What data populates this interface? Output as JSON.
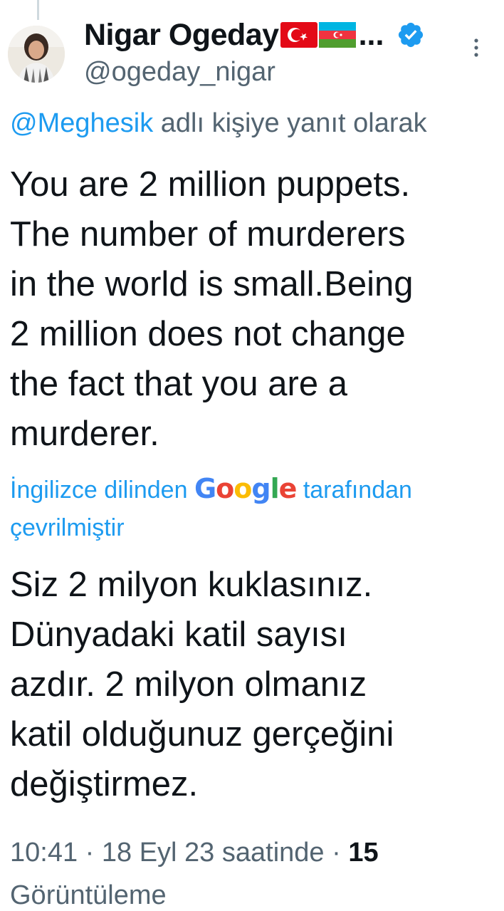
{
  "author": {
    "display_name": "Nigar Ogeday",
    "handle": "@ogeday_nigar",
    "truncation": "...",
    "flags": [
      "turkey-flag",
      "azerbaijan-flag"
    ],
    "verified": true
  },
  "reply": {
    "mention": "@Meghesik",
    "suffix": " adlı kişiye yanıt olarak"
  },
  "tweet": {
    "lines": [
      "You are 2 million puppets.",
      "The number of murderers",
      "in the world is small.Being",
      "2 million does not change",
      "the fact that you are a",
      "murderer."
    ]
  },
  "translation": {
    "prefix": "İngilizce dilinden ",
    "google_letters": [
      "G",
      "o",
      "o",
      "g",
      "l",
      "e"
    ],
    "google_colors": [
      "#4285F4",
      "#EA4335",
      "#FBBC05",
      "#4285F4",
      "#34A853",
      "#EA4335"
    ],
    "suffix": " tarafından çevrilmiştir",
    "lines": [
      "Siz 2 milyon kuklasınız.",
      "Dünyadaki katil sayısı",
      "azdır. 2 milyon olmanız",
      "katil olduğunuz gerçeğini",
      "değiştirmez."
    ]
  },
  "meta": {
    "time": "10:41",
    "separator1": " · ",
    "date": "18 Eyl 23 saatinde",
    "separator2": " · ",
    "views_count": "15",
    "views_label": "Görüntüleme"
  },
  "colors": {
    "link": "#1d9bf0",
    "secondary_text": "#536471",
    "primary_text": "#0f1419",
    "verified_badge": "#1d9bf0"
  },
  "icons": {
    "verified": "verified-badge-icon",
    "more": "more-vertical-icon"
  }
}
